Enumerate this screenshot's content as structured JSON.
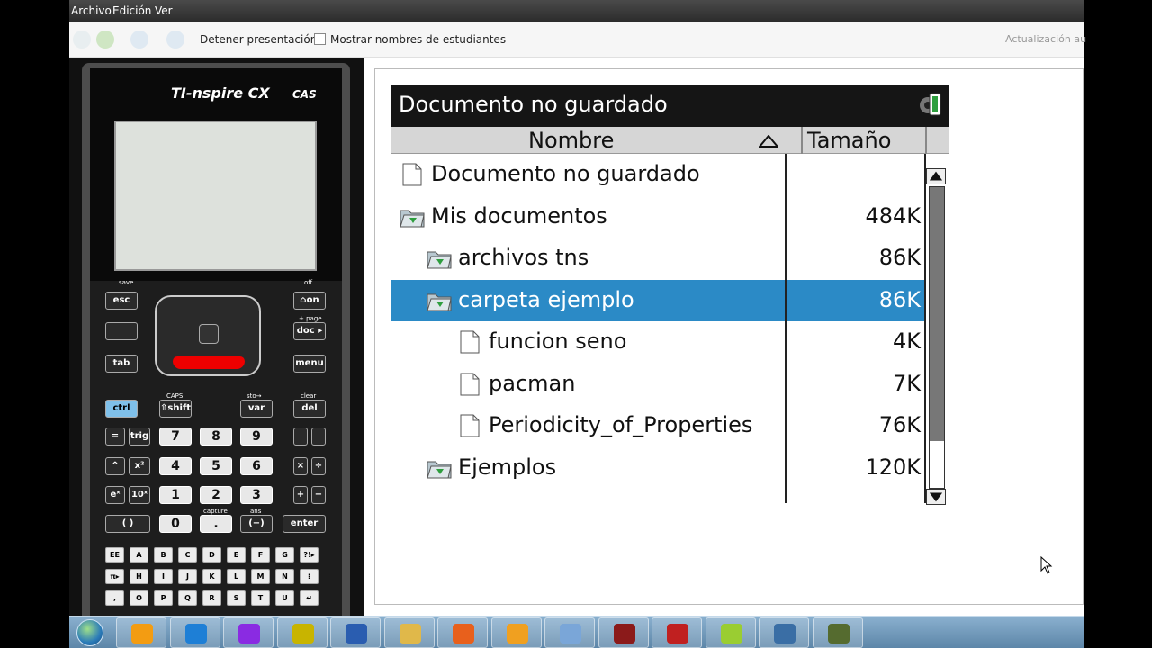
{
  "menu": {
    "file": "Archivo",
    "edit": "Edición",
    "view": "Ver"
  },
  "toolbar": {
    "stop_presentation": "Detener presentación",
    "show_student_names": "Mostrar nombres de estudiantes",
    "update_status": "Actualización au"
  },
  "calculator": {
    "brand_prefix": "TI-",
    "brand_name": "nspire CX",
    "cas": "CAS",
    "keys": {
      "esc": "esc",
      "on": "⌂on",
      "doc": "doc ▸",
      "menu": "menu",
      "tab": "tab",
      "ctrl": "ctrl",
      "shift": "⇧shift",
      "var": "var",
      "del": "del",
      "equals": "=",
      "trig": "trig",
      "caret": "^",
      "x2": "x²",
      "ex": "eˣ",
      "ten_x": "10ˣ",
      "paren": "( )",
      "mult": "×",
      "div": "÷",
      "plus": "+",
      "minus": "−",
      "neg": "(−)",
      "enter": "enter",
      "n7": "7",
      "n8": "8",
      "n9": "9",
      "n4": "4",
      "n5": "5",
      "n6": "6",
      "n1": "1",
      "n2": "2",
      "n3": "3",
      "n0": "0",
      "dot": "."
    },
    "labels": {
      "save": "save",
      "off": "off",
      "page": "+ page",
      "caps": "CAPS",
      "sto": "sto→",
      "clear": "clear",
      "capture": "capture",
      "ans": "ans"
    },
    "alpha_rows": [
      [
        "EE",
        "A",
        "B",
        "C",
        "D",
        "E",
        "F",
        "G",
        "?!▸"
      ],
      [
        "π▸",
        "H",
        "I",
        "J",
        "K",
        "L",
        "M",
        "N",
        "⁝"
      ],
      [
        ",",
        "O",
        "P",
        "Q",
        "R",
        "S",
        "T",
        "U",
        "↵"
      ]
    ]
  },
  "document": {
    "title": "Documento no guardado",
    "col_name": "Nombre",
    "col_size": "Tamaño",
    "rows": [
      {
        "name": "Documento no guardado",
        "size": "",
        "type": "file",
        "level": 0
      },
      {
        "name": "Mis documentos",
        "size": "484K",
        "type": "folder",
        "level": 0
      },
      {
        "name": "archivos tns",
        "size": "86K",
        "type": "folder",
        "level": 1
      },
      {
        "name": "carpeta ejemplo",
        "size": "86K",
        "type": "folder",
        "level": 1,
        "selected": true
      },
      {
        "name": "funcion seno",
        "size": "4K",
        "type": "file",
        "level": 2
      },
      {
        "name": "pacman",
        "size": "7K",
        "type": "file",
        "level": 2
      },
      {
        "name": "Periodicity_of_Properties",
        "size": "76K",
        "type": "file",
        "level": 2
      },
      {
        "name": "Ejemplos",
        "size": "120K",
        "type": "folder",
        "level": 1
      }
    ]
  },
  "taskbar": {
    "items": [
      "media-player-icon",
      "internet-explorer-icon",
      "onenote-icon",
      "lock-app-icon",
      "word-icon",
      "folder-icon",
      "firefox-icon",
      "outlook-icon",
      "paint-icon",
      "winrar-icon",
      "ti-cas-icon",
      "notes-icon",
      "network-tool-icon",
      "camera-tool-icon"
    ],
    "colors": [
      "#f39c12",
      "#1e7fd6",
      "#8a2be2",
      "#c8b400",
      "#2a5db0",
      "#e0b84a",
      "#e8601c",
      "#f0a020",
      "#7aa6d8",
      "#8b1a1a",
      "#c02020",
      "#9acd32",
      "#3a6ea5",
      "#556b2f"
    ]
  }
}
